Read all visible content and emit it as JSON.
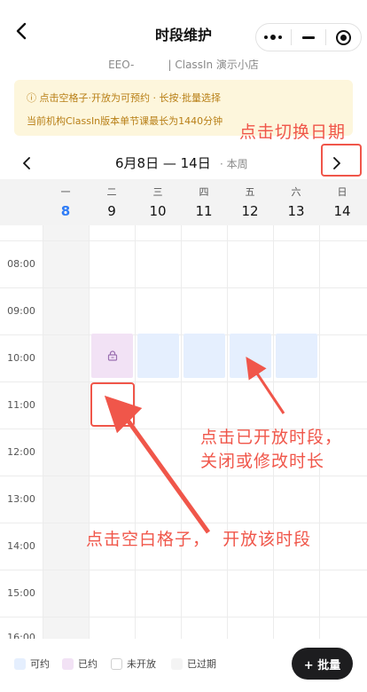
{
  "header": {
    "title": "时段维护",
    "subtitle": "EEO-          | ClassIn 演示小店"
  },
  "notice": {
    "line1": "ⓘ 点击空格子·开放为可预约 · 长按·批量选择",
    "line2": "当前机构ClassIn版本单节课最长为1440分钟"
  },
  "week_nav": {
    "prev": "<",
    "range": "6月8日 — 14日",
    "this_week": "· 本周",
    "next": ">"
  },
  "days": [
    {
      "weekday": "一",
      "date": "8",
      "today": true
    },
    {
      "weekday": "二",
      "date": "9"
    },
    {
      "weekday": "三",
      "date": "10"
    },
    {
      "weekday": "四",
      "date": "11"
    },
    {
      "weekday": "五",
      "date": "12"
    },
    {
      "weekday": "六",
      "date": "13"
    },
    {
      "weekday": "日",
      "date": "14"
    }
  ],
  "hours": [
    "08:00",
    "09:00",
    "10:00",
    "11:00",
    "12:00",
    "13:00",
    "14:00",
    "15:00",
    "16:00"
  ],
  "annotations": {
    "switch_date": "点击切换日期",
    "open_slot": "点击已开放时段，\n关闭或修改时长",
    "blank_slot": "点击空白格子，  开放该时段"
  },
  "legend": [
    {
      "label": "可约",
      "color": "#e5effe"
    },
    {
      "label": "已约",
      "color": "#f2e2f5"
    },
    {
      "label": "未开放",
      "color": "#ffffff"
    },
    {
      "label": "已过期",
      "color": "#f4f4f4"
    }
  ],
  "batch_button": "+ 批量",
  "colors": {
    "accent": "#2f7cf6",
    "annotation": "#f0564a",
    "notice_bg": "#fdf6dc",
    "notice_text": "#b87f16"
  }
}
